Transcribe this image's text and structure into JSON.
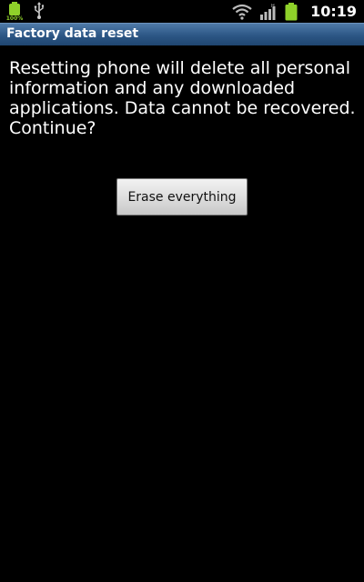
{
  "status_bar": {
    "battery_small_pct": "100%",
    "time": "10:19",
    "icons": [
      "battery-small-icon",
      "usb-icon",
      "wifi-icon",
      "signal-icon",
      "battery-icon"
    ],
    "accent_color": "#8fd12a"
  },
  "title_bar": {
    "title": "Factory data reset",
    "background_color": "#2c5685"
  },
  "content": {
    "message": "Resetting phone will delete all personal information and any downloaded applications. Data cannot be recovered. Continue?",
    "erase_button_label": "Erase everything"
  }
}
